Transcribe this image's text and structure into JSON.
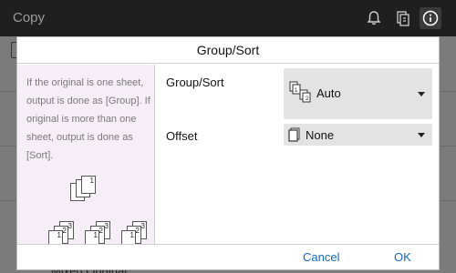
{
  "app": {
    "title": "Copy"
  },
  "topbar_icons": [
    "bell-icon",
    "copy-history-icon",
    "info-icon"
  ],
  "dialog": {
    "title": "Group/Sort",
    "help_text": "If the original is one sheet, output is done as [Group]. If original is more than one sheet, output is done as [Sort].",
    "illustration": {
      "top_stack": [
        "1",
        "1",
        "1"
      ],
      "bottom_stacks": [
        [
          "3",
          "2",
          "1"
        ],
        [
          "3",
          "2",
          "1"
        ],
        [
          "3",
          "2",
          "1"
        ]
      ]
    },
    "settings": [
      {
        "label": "Group/Sort",
        "value": "Auto",
        "icon": "group-sort-icon"
      },
      {
        "label": "Offset",
        "value": "None",
        "icon": "offset-none-icon"
      }
    ],
    "buttons": {
      "cancel": "Cancel",
      "ok": "OK"
    }
  },
  "background": {
    "bottom_text": "Mixed Original"
  },
  "colors": {
    "accent": "#1565c0",
    "help_bg": "#f6eef6",
    "select_bg": "#e3e3e3"
  }
}
